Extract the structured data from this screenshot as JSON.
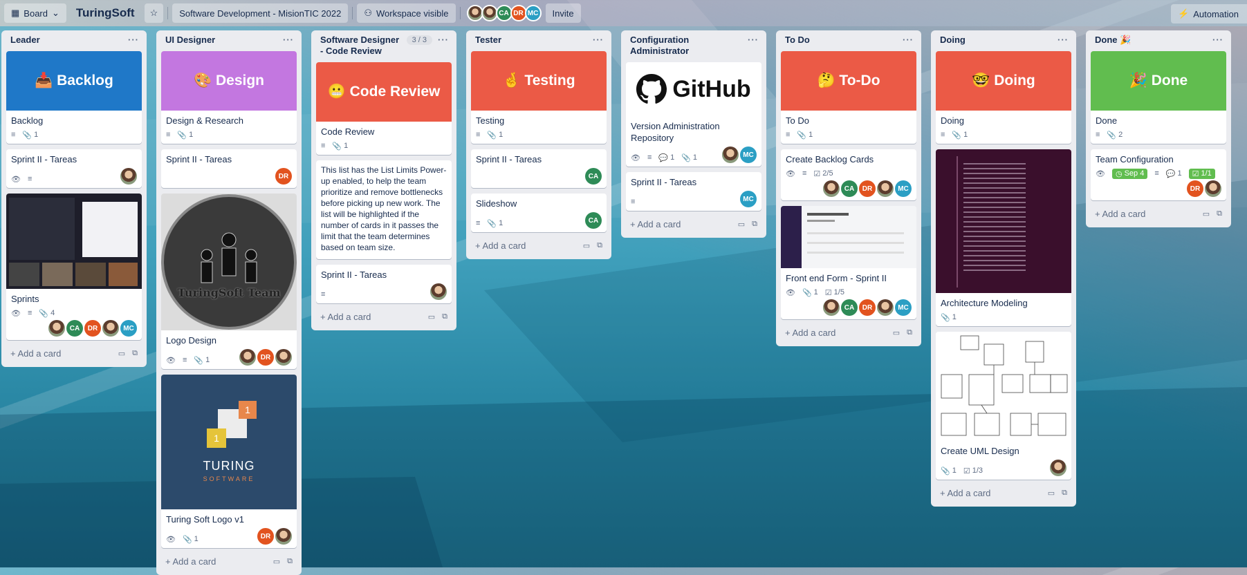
{
  "header": {
    "board_switch": "Board",
    "board_title": "TuringSoft",
    "workspace": "Software Development - MisionTIC 2022",
    "visibility": "Workspace visible",
    "members": [
      "CA",
      "DR",
      "MC"
    ],
    "invite": "Invite",
    "automation": "Automation"
  },
  "add_card": "Add a card",
  "colors": {
    "blue_cover": "#1f78c8",
    "purple_cover": "#c377e0",
    "red_cover": "#eb5a46",
    "green_cover": "#61bd4f",
    "avatar_ca": "#2e8b57",
    "avatar_dr": "#e2531f",
    "avatar_mc": "#2b9fc4"
  },
  "lists": [
    {
      "title": "Leader",
      "cards": [
        {
          "cover_text": "📥 Backlog",
          "title": "Backlog",
          "attachments": "1"
        },
        {
          "title": "Sprint II - Tareas"
        },
        {
          "title": "Sprints",
          "attachments": "4",
          "members": [
            "CA",
            "DR",
            "MC"
          ]
        }
      ]
    },
    {
      "title": "UI Designer",
      "cards": [
        {
          "cover_text": "🎨 Design",
          "title": "Design & Research",
          "attachments": "1"
        },
        {
          "title": "Sprint II - Tareas",
          "members": [
            "DR"
          ]
        },
        {
          "title": "Logo Design",
          "attachments": "1",
          "logo_text": "TuringSoft Team",
          "members": [
            "DR"
          ]
        },
        {
          "title": "Turing Soft Logo v1",
          "attachments": "1",
          "logo_word": "TURING",
          "logo_sub": "SOFTWARE",
          "logo_num": "1",
          "members": [
            "DR"
          ]
        }
      ]
    },
    {
      "title": "Software Designer - Code Review",
      "limit": "3 / 3",
      "cards": [
        {
          "cover_text": "😬 Code Review",
          "title": "Code Review",
          "attachments": "1"
        },
        {
          "title": "This list has the List Limits Power-up enabled, to help the team prioritize and remove bottlenecks before picking up new work. The list will be highlighted if the number of cards in it passes the limit that the team determines based on team size."
        },
        {
          "title": "Sprint II - Tareas"
        }
      ]
    },
    {
      "title": "Tester",
      "cards": [
        {
          "cover_text": "🤞 Testing",
          "title": "Testing",
          "attachments": "1"
        },
        {
          "title": "Sprint II - Tareas",
          "members": [
            "CA"
          ]
        },
        {
          "title": "Slideshow",
          "attachments": "1",
          "members": [
            "CA"
          ]
        }
      ]
    },
    {
      "title": "Configuration Administrator",
      "cards": [
        {
          "cover_text": "GitHub",
          "title": "Version Administration Repository",
          "comments": "1",
          "attachments": "1",
          "members": [
            "MC"
          ]
        },
        {
          "title": "Sprint II - Tareas",
          "members": [
            "MC"
          ]
        }
      ]
    },
    {
      "title": "To Do",
      "cards": [
        {
          "cover_text": "🤔 To-Do",
          "title": "To Do",
          "attachments": "1"
        },
        {
          "title": "Create Backlog Cards",
          "checklist": "2/5",
          "members": [
            "CA",
            "DR",
            "MC"
          ]
        },
        {
          "title": "Front end Form - Sprint II",
          "attachments": "1",
          "checklist": "1/5",
          "members": [
            "CA",
            "DR",
            "MC"
          ]
        }
      ]
    },
    {
      "title": "Doing",
      "cards": [
        {
          "cover_text": "🤓 Doing",
          "title": "Doing",
          "attachments": "1"
        },
        {
          "title": "Architecture Modeling",
          "attachments": "1"
        },
        {
          "title": "Create UML Design",
          "attachments": "1",
          "checklist": "1/3"
        }
      ]
    },
    {
      "title": "Done 🎉",
      "cards": [
        {
          "cover_text": "🎉 Done",
          "title": "Done",
          "attachments": "2"
        },
        {
          "title": "Team Configuration",
          "due": "Sep 4",
          "comments": "1",
          "checklist": "1/1",
          "members": [
            "DR"
          ]
        }
      ]
    }
  ]
}
